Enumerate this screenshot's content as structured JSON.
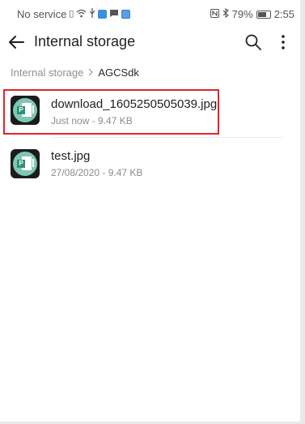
{
  "status_bar": {
    "carrier": "No service",
    "battery": "79%",
    "time": "2:55"
  },
  "app_bar": {
    "title": "Internal storage"
  },
  "breadcrumb": {
    "root": "Internal storage",
    "current": "AGCSdk"
  },
  "files": [
    {
      "name": "download_1605250505039.jpg",
      "meta": "Just now - 9.47 KB",
      "icon": "image-file-icon",
      "highlighted": true
    },
    {
      "name": "test.jpg",
      "meta": "27/08/2020 - 9.47 KB",
      "icon": "image-file-icon",
      "highlighted": false
    }
  ],
  "colors": {
    "highlight": "#e0242c",
    "icon_teal": "#7fc7b4",
    "icon_bg": "#1c1c1c"
  }
}
